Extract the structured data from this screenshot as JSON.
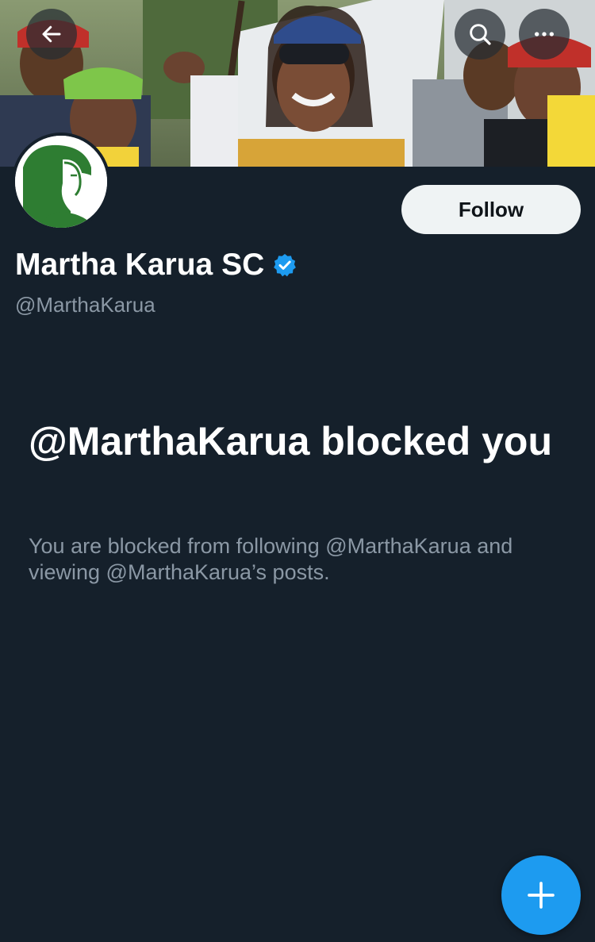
{
  "header": {
    "back_icon": "arrow-left-icon",
    "search_icon": "search-icon",
    "more_icon": "more-horizontal-icon"
  },
  "profile": {
    "display_name": "Martha Karua SC",
    "verified_icon": "verified-badge-icon",
    "handle": "@MarthaKarua",
    "follow_label": "Follow"
  },
  "blocked": {
    "title": "@MarthaKarua blocked you",
    "description": "You are blocked from following @MarthaKarua and viewing @MarthaKarua’s posts."
  },
  "fab": {
    "icon": "plus-icon"
  },
  "colors": {
    "background": "#15202b",
    "accent": "#1d9bf0",
    "secondary_text": "#8b98a5",
    "follow_button_bg": "#eff3f4"
  }
}
